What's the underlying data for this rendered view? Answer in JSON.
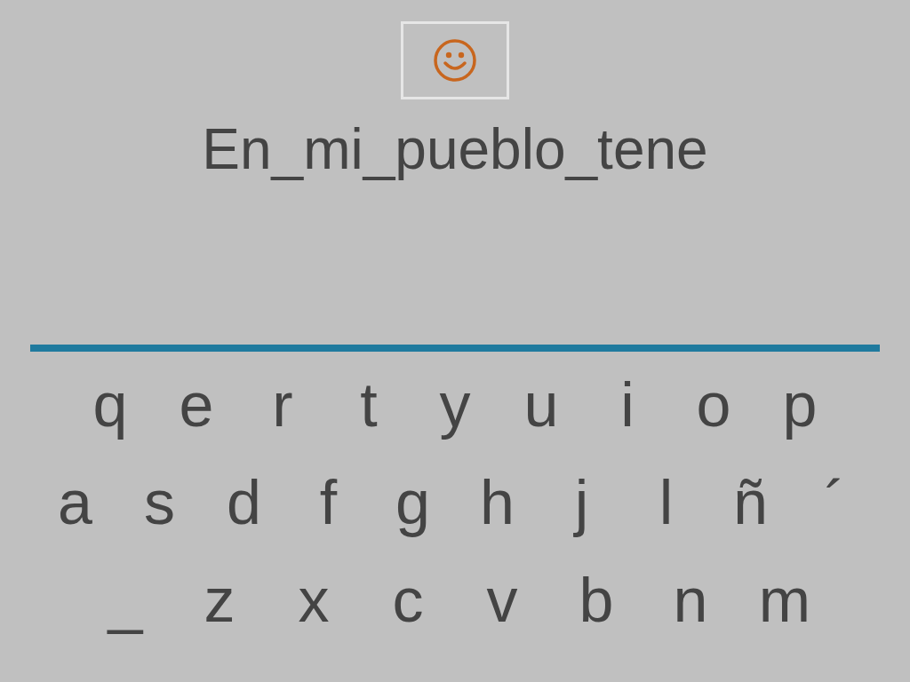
{
  "phrase": "En_mi_pueblo_tene",
  "keyboard": {
    "rows": [
      [
        "q",
        "e",
        "r",
        "t",
        "y",
        "u",
        "i",
        "o",
        "p"
      ],
      [
        "a",
        "s",
        "d",
        "f",
        "g",
        "h",
        "j",
        "l",
        "ñ",
        "´"
      ],
      [
        "_",
        "z",
        "x",
        "c",
        "v",
        "b",
        "n",
        "m"
      ]
    ]
  }
}
